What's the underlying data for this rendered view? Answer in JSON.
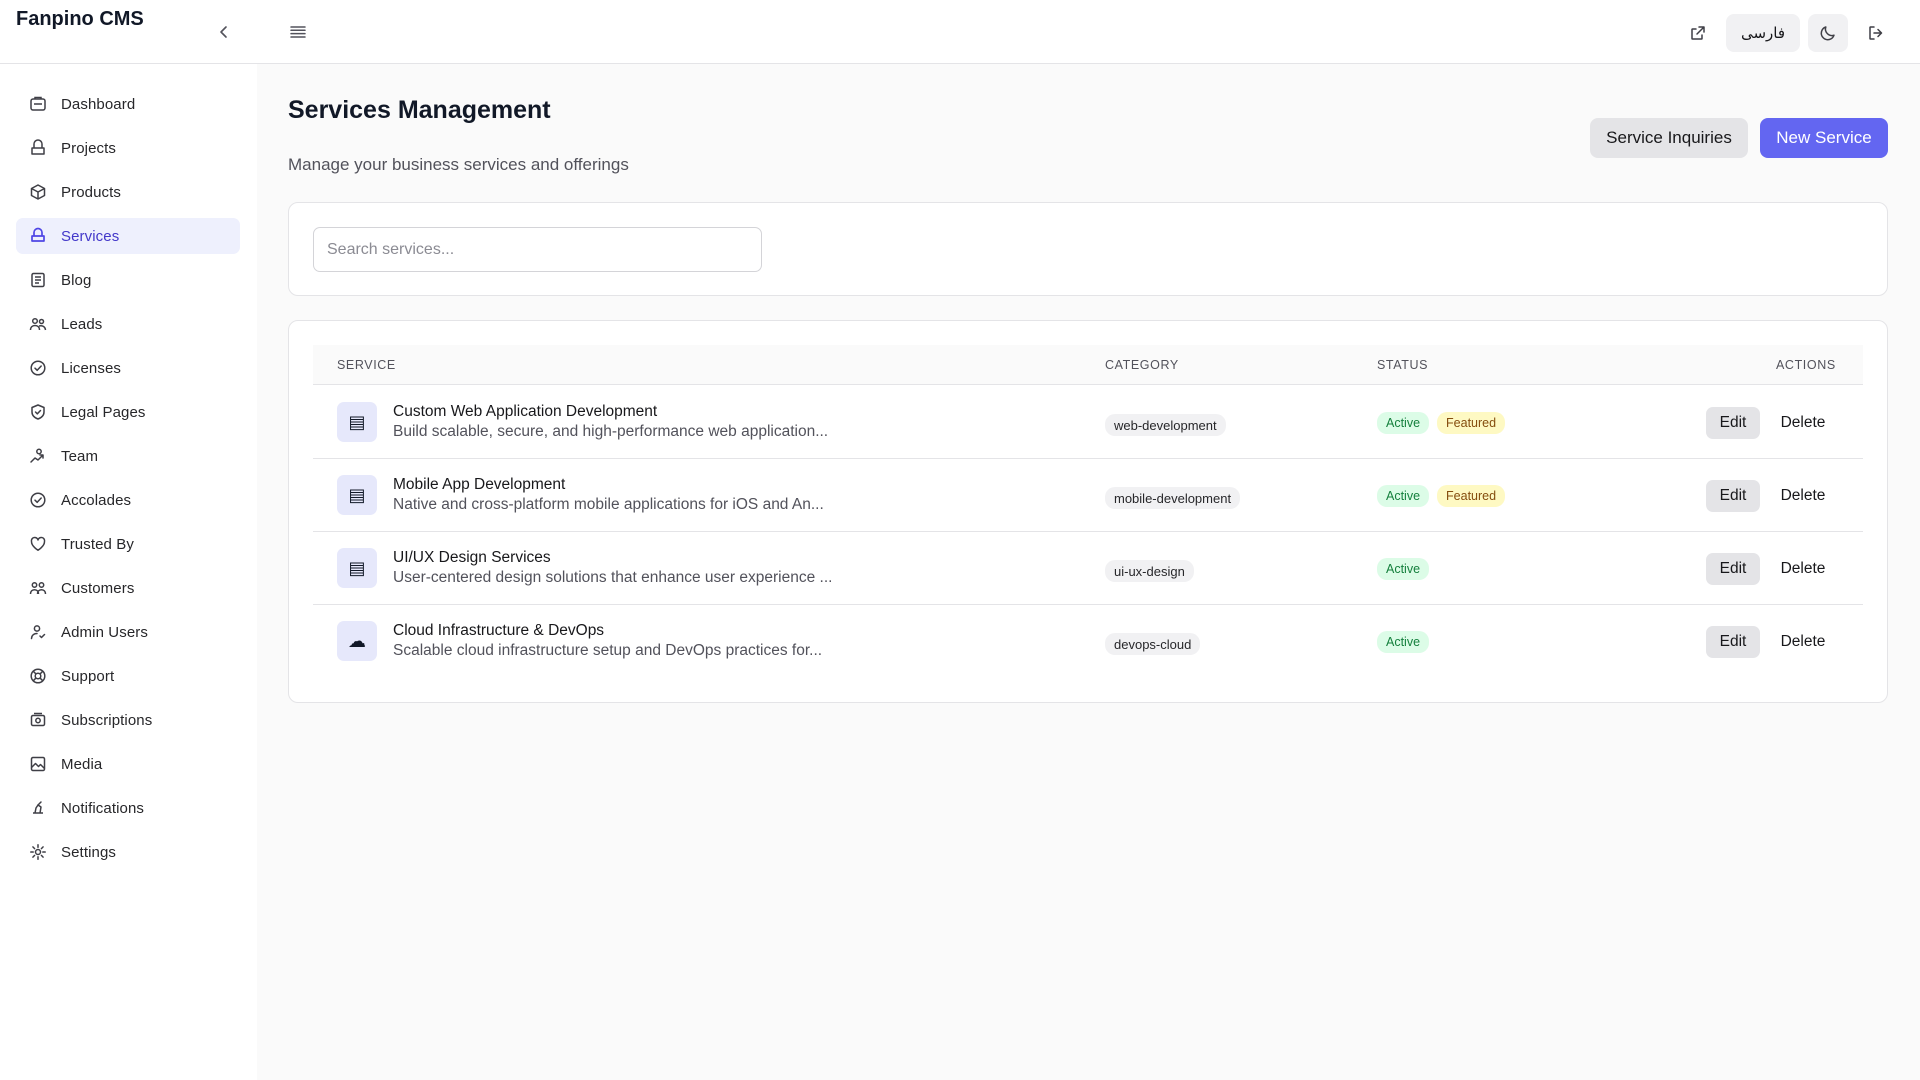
{
  "app": {
    "title": "Fanpino CMS"
  },
  "topbar": {
    "collapse_icon": "chevron-left-icon",
    "menu_icon": "menu-icon",
    "external_icon": "external-link-icon",
    "language_label": "فارسی",
    "theme_icon": "moon-icon",
    "logout_icon": "logout-icon"
  },
  "sidebar": {
    "items": [
      {
        "label": "Dashboard",
        "icon": "dashboard-icon",
        "active": false
      },
      {
        "label": "Projects",
        "icon": "projects-icon",
        "active": false
      },
      {
        "label": "Products",
        "icon": "package-icon",
        "active": false
      },
      {
        "label": "Services",
        "icon": "services-icon",
        "active": true
      },
      {
        "label": "Blog",
        "icon": "blog-icon",
        "active": false
      },
      {
        "label": "Leads",
        "icon": "leads-icon",
        "active": false
      },
      {
        "label": "Licenses",
        "icon": "check-circle-icon",
        "active": false
      },
      {
        "label": "Legal Pages",
        "icon": "shield-icon",
        "active": false
      },
      {
        "label": "Team",
        "icon": "team-icon",
        "active": false
      },
      {
        "label": "Accolades",
        "icon": "badge-check-icon",
        "active": false
      },
      {
        "label": "Trusted By",
        "icon": "heart-icon",
        "active": false
      },
      {
        "label": "Customers",
        "icon": "customers-icon",
        "active": false
      },
      {
        "label": "Admin Users",
        "icon": "admin-users-icon",
        "active": false
      },
      {
        "label": "Support",
        "icon": "lifebuoy-icon",
        "active": false
      },
      {
        "label": "Subscriptions",
        "icon": "subscriptions-icon",
        "active": false
      },
      {
        "label": "Media",
        "icon": "image-icon",
        "active": false
      },
      {
        "label": "Notifications",
        "icon": "bell-icon",
        "active": false
      },
      {
        "label": "Settings",
        "icon": "gear-icon",
        "active": false
      }
    ]
  },
  "main": {
    "title": "Services Management",
    "subtitle": "Manage your business services and offerings",
    "inquiries_label": "Service Inquiries",
    "new_label": "New Service",
    "search": {
      "placeholder": "Search services...",
      "value": ""
    },
    "table": {
      "headers": [
        "SERVICE",
        "CATEGORY",
        "STATUS",
        "ACTIONS"
      ],
      "rows": [
        {
          "icon": "server-icon",
          "icon_glyph": "▤",
          "name": "Custom Web Application Development",
          "description": "Build scalable, secure, and high-performance web application...",
          "category": "web-development",
          "status": "Active",
          "featured": "Featured",
          "edit": "Edit",
          "delete": "Delete"
        },
        {
          "icon": "server-icon",
          "icon_glyph": "▤",
          "name": "Mobile App Development",
          "description": "Native and cross-platform mobile applications for iOS and An...",
          "category": "mobile-development",
          "status": "Active",
          "featured": "Featured",
          "edit": "Edit",
          "delete": "Delete"
        },
        {
          "icon": "server-icon",
          "icon_glyph": "▤",
          "name": "UI/UX Design Services",
          "description": "User-centered design solutions that enhance user experience ...",
          "category": "ui-ux-design",
          "status": "Active",
          "featured": "",
          "edit": "Edit",
          "delete": "Delete"
        },
        {
          "icon": "cloud-icon",
          "icon_glyph": "☁",
          "name": "Cloud Infrastructure & DevOps",
          "description": "Scalable cloud infrastructure setup and DevOps practices for...",
          "category": "devops-cloud",
          "status": "Active",
          "featured": "",
          "edit": "Edit",
          "delete": "Delete"
        }
      ]
    }
  },
  "colors": {
    "accent": "#6366f1",
    "active_nav_bg": "#eef0fd",
    "active_badge_bg": "#dcfce7",
    "active_badge_text": "#15803d",
    "featured_badge_bg": "#fef9c3",
    "featured_badge_text": "#854d0e"
  }
}
